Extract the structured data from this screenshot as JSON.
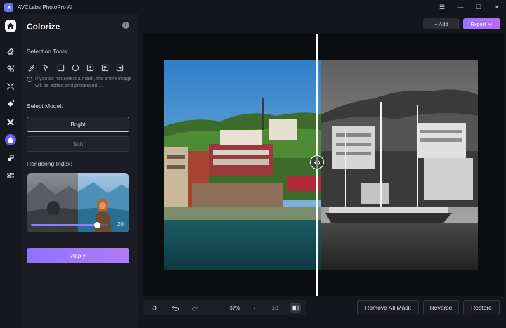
{
  "app": {
    "title": "AVCLabs PhotoPro AI"
  },
  "panel": {
    "title": "Colorize",
    "selection_tools_label": "Selection Tools:",
    "selection_hint": "If you do not select a mask, the entire image will be edited and processed ...",
    "select_model_label": "Select Model:",
    "models": [
      "Bright",
      "Soft"
    ],
    "selected_model": "Bright",
    "rendering_index_label": "Rendering Index:",
    "rendering_index_value": "20",
    "rendering_index_fraction": 0.85,
    "apply_label": "Apply"
  },
  "toolbar": {
    "add_label": "+ Add",
    "export_label": "Export"
  },
  "bottom": {
    "zoom_minus": "−",
    "zoom_value": "37%",
    "zoom_plus": "+",
    "ratio_label": "1:1",
    "remove_mask_label": "Remove All Mask",
    "reverse_label": "Reverse",
    "restore_label": "Restore"
  },
  "colors": {
    "accent": "#7b66ff",
    "export_gradient": "#b86cf2"
  },
  "icons": {
    "rail": [
      "home-icon",
      "eraser-icon",
      "face-icon",
      "enlarge-icon",
      "enhance-icon",
      "remove-object-icon",
      "colorize-icon",
      "crop-icon",
      "adjust-icon"
    ],
    "tools": [
      "brush-icon",
      "lasso-icon",
      "rectangle-icon",
      "ellipse-icon",
      "portrait-icon",
      "object-icon",
      "invert-icon"
    ]
  }
}
